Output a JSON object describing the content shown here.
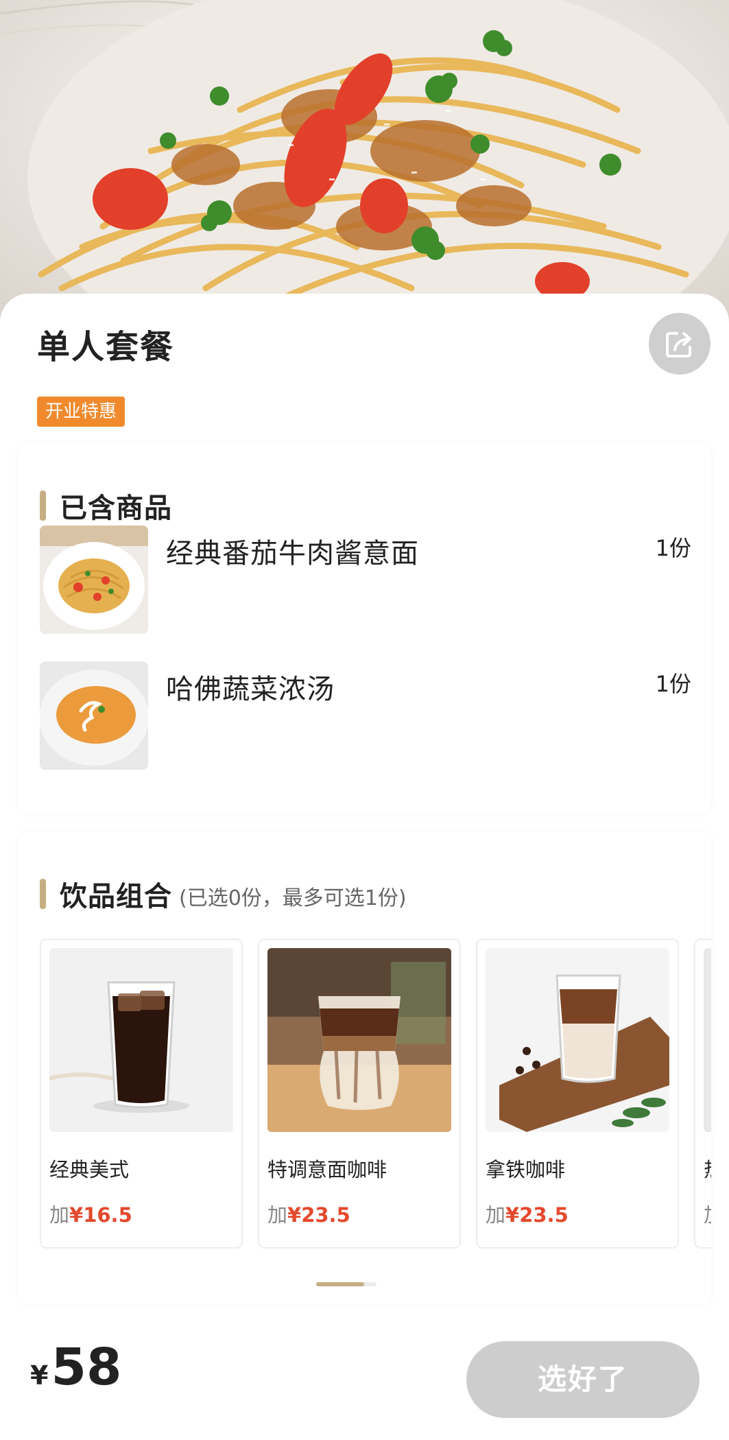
{
  "product": {
    "title": "单人套餐",
    "promo_badge": "开业特惠"
  },
  "included": {
    "title": "已含商品",
    "items": [
      {
        "name": "经典番茄牛肉酱意面",
        "qty": "1份",
        "thumb_icon": "pasta-photo"
      },
      {
        "name": "哈佛蔬菜浓汤",
        "qty": "1份",
        "thumb_icon": "soup-photo"
      }
    ]
  },
  "drinks": {
    "title": "饮品组合",
    "subtitle": "(已选0份，最多可选1份)",
    "items": [
      {
        "name": "经典美式",
        "price_prefix": "加",
        "price": "¥16.5",
        "image_icon": "iced-americano-photo"
      },
      {
        "name": "特调意面咖啡",
        "price_prefix": "加",
        "price": "¥23.5",
        "image_icon": "layered-coffee-photo"
      },
      {
        "name": "拿铁咖啡",
        "price_prefix": "加",
        "price": "¥23.5",
        "image_icon": "iced-latte-photo"
      },
      {
        "name": "热",
        "price_prefix": "加",
        "price": "",
        "image_icon": "drink-photo"
      }
    ]
  },
  "footer": {
    "currency": "¥",
    "total": "58",
    "confirm_label": "选好了"
  },
  "colors": {
    "accent_gold": "#c6ad82",
    "promo_orange": "#f08a2c",
    "price_red": "#e4492d",
    "disabled_button": "#cdcdcd"
  }
}
